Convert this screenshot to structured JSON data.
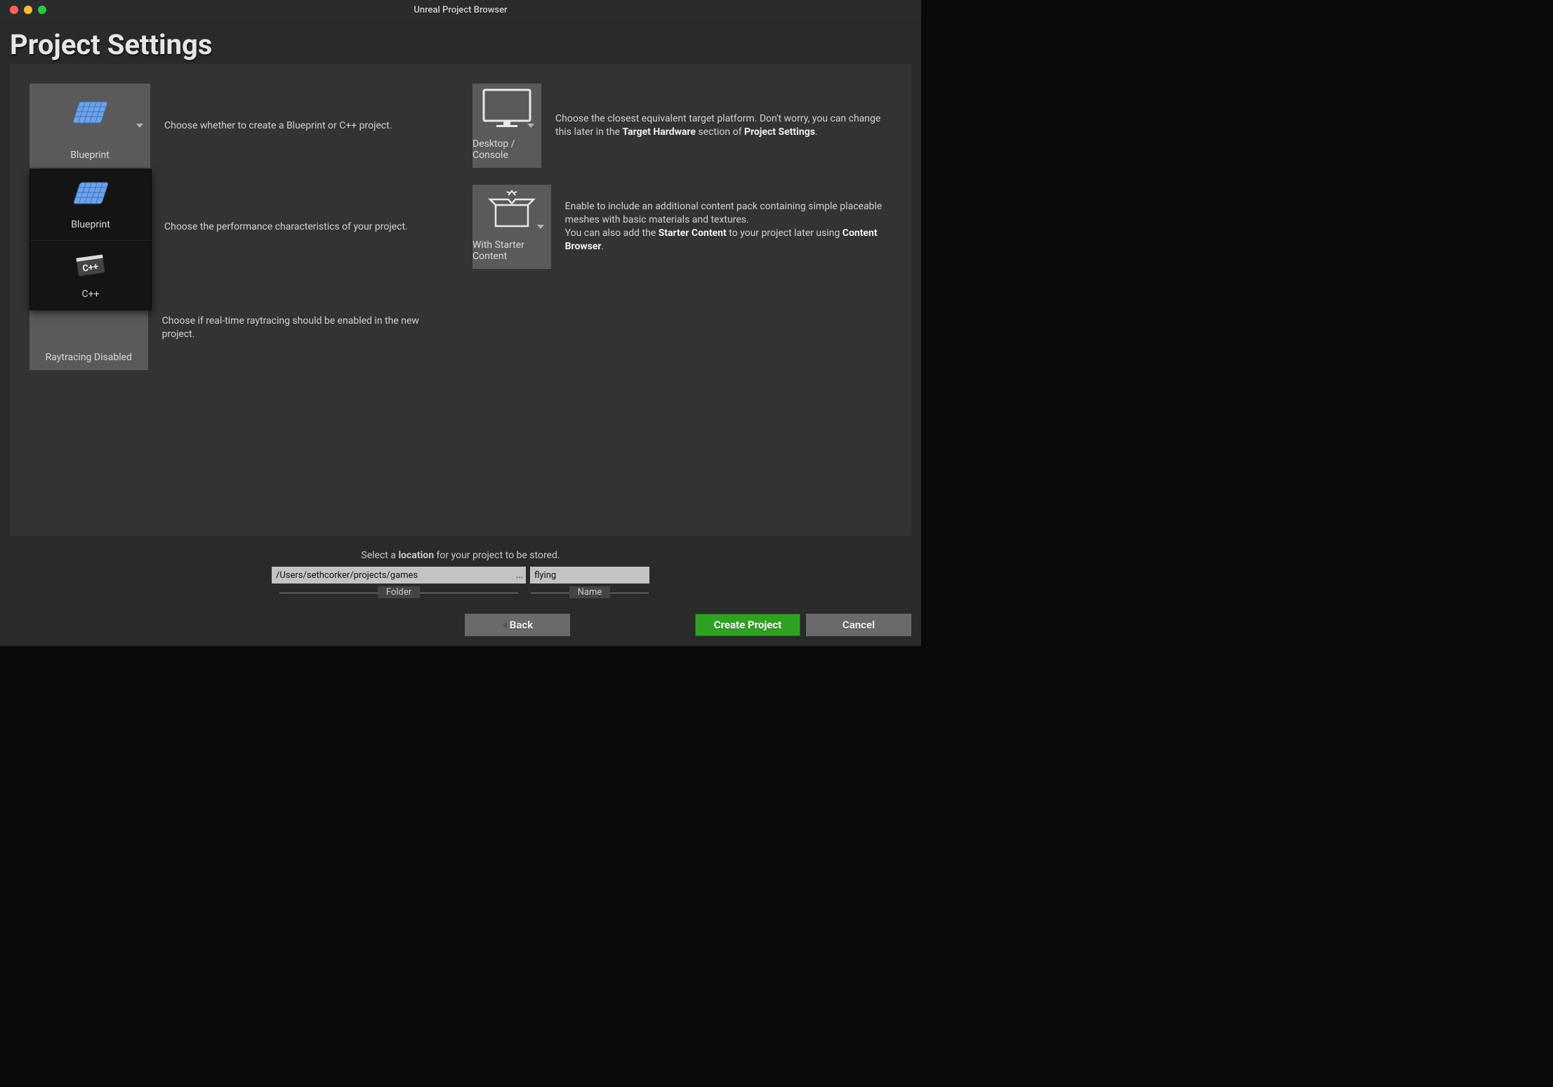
{
  "window": {
    "title": "Unreal Project Browser"
  },
  "page_title": "Project Settings",
  "left": {
    "blueprint": {
      "label": "Blueprint",
      "desc": "Choose whether to create a Blueprint or C++ project."
    },
    "performance": {
      "desc": "Choose the performance characteristics of your project."
    },
    "raytrace": {
      "label": "Raytracing Disabled",
      "desc": "Choose if real-time raytracing should be enabled in the new project."
    }
  },
  "right": {
    "platform": {
      "label": "Desktop / Console",
      "desc_pre": "Choose the closest equivalent target platform. Don't worry, you can change this later in the ",
      "desc_bold1": "Target Hardware",
      "desc_mid": " section of ",
      "desc_bold2": "Project Settings",
      "desc_post": "."
    },
    "starter": {
      "label": "With Starter Content",
      "desc_l1": "Enable to include an additional content pack containing simple placeable meshes with basic materials and textures.",
      "desc_l2a": "You can also add the ",
      "desc_l2b": "Starter Content",
      "desc_l2c": " to your project later using ",
      "desc_l2d": "Content Browser",
      "desc_l2e": "."
    }
  },
  "dropdown": {
    "items": [
      {
        "label": "Blueprint"
      },
      {
        "label": "C++"
      }
    ]
  },
  "footer": {
    "location_pre": "Select a ",
    "location_bold": "location",
    "location_post": " for your project to be stored.",
    "folder_value": "/Users/sethcorker/projects/games",
    "folder_label": "Folder",
    "name_value": "flying",
    "name_label": "Name",
    "browse": "...",
    "btn_back": "Back",
    "btn_create": "Create Project",
    "btn_cancel": "Cancel"
  }
}
